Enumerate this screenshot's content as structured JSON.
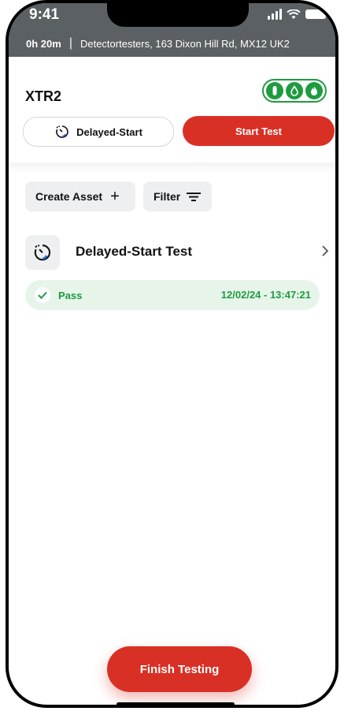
{
  "status_bar": {
    "time": "9:41"
  },
  "location_bar": {
    "duration": "0h 20m",
    "separator": "|",
    "address": "Detectortesters, 163 Dixon Hill Rd, MX12 UK2"
  },
  "device": {
    "title": "XTR2",
    "badges": [
      "detector-icon",
      "drop-icon",
      "flame-icon"
    ]
  },
  "actions": {
    "delayed_start_label": "Delayed-Start",
    "start_test_label": "Start Test"
  },
  "toolbar": {
    "create_asset_label": "Create Asset",
    "create_asset_icon": "+",
    "filter_label": "Filter"
  },
  "test_item": {
    "title": "Delayed-Start Test",
    "chevron": "›"
  },
  "result": {
    "status": "Pass",
    "timestamp": "12/02/24 - 13:47:21"
  },
  "footer": {
    "finish_label": "Finish Testing"
  },
  "colors": {
    "accent_red": "#d93025",
    "pass_green": "#1f9b3f",
    "header_gray": "#5a6063"
  }
}
